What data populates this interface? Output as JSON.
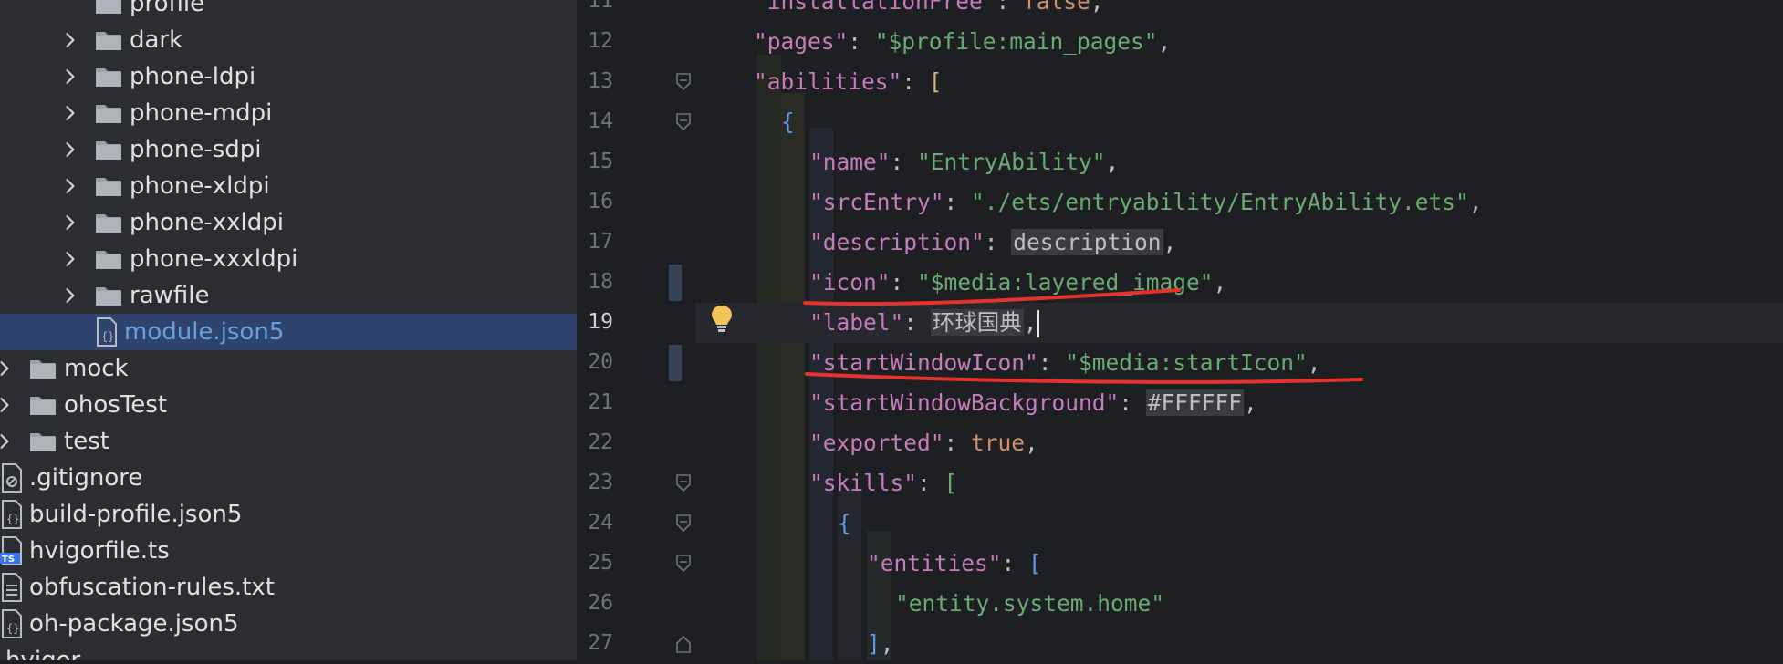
{
  "tree": {
    "items": [
      {
        "label": "profile",
        "kind": "folder",
        "expandable": false,
        "indent": 2
      },
      {
        "label": "dark",
        "kind": "folder",
        "expandable": true,
        "indent": 2
      },
      {
        "label": "phone-ldpi",
        "kind": "folder",
        "expandable": true,
        "indent": 2
      },
      {
        "label": "phone-mdpi",
        "kind": "folder",
        "expandable": true,
        "indent": 2
      },
      {
        "label": "phone-sdpi",
        "kind": "folder",
        "expandable": true,
        "indent": 2
      },
      {
        "label": "phone-xldpi",
        "kind": "folder",
        "expandable": true,
        "indent": 2
      },
      {
        "label": "phone-xxldpi",
        "kind": "folder",
        "expandable": true,
        "indent": 2
      },
      {
        "label": "phone-xxxldpi",
        "kind": "folder",
        "expandable": true,
        "indent": 2
      },
      {
        "label": "rawfile",
        "kind": "folder",
        "expandable": true,
        "indent": 2
      },
      {
        "label": "module.json5",
        "kind": "json5",
        "expandable": false,
        "indent": 2,
        "selected": true
      },
      {
        "label": "mock",
        "kind": "folder",
        "expandable": true,
        "indent": 1
      },
      {
        "label": "ohosTest",
        "kind": "folder",
        "expandable": true,
        "indent": 1
      },
      {
        "label": "test",
        "kind": "folder",
        "expandable": true,
        "indent": 1
      },
      {
        "label": ".gitignore",
        "kind": "ignore",
        "expandable": false,
        "indent": 0
      },
      {
        "label": "build-profile.json5",
        "kind": "json5",
        "expandable": false,
        "indent": 0
      },
      {
        "label": "hvigorfile.ts",
        "kind": "ts",
        "expandable": false,
        "indent": 0
      },
      {
        "label": "obfuscation-rules.txt",
        "kind": "txt",
        "expandable": false,
        "indent": 0
      },
      {
        "label": "oh-package.json5",
        "kind": "json5",
        "expandable": false,
        "indent": 0
      },
      {
        "label": "hvigor",
        "kind": "folder",
        "expandable": false,
        "indent": -1
      }
    ]
  },
  "editor": {
    "active_line": "19",
    "lines": [
      {
        "num": "11",
        "depth": 0,
        "html": "<span class=\"k\">\"installationFree\"</span><span class=\"p\">: </span><span class=\"o\">false</span><span class=\"p\">,</span>"
      },
      {
        "num": "12",
        "depth": 0,
        "html": "<span class=\"k\">\"pages\"</span><span class=\"p\">: </span><span class=\"s\">\"$profile:main_pages\"</span><span class=\"p\">,</span>"
      },
      {
        "num": "13",
        "depth": 0,
        "html": "<span class=\"k\">\"abilities\"</span><span class=\"p\">: </span><span class=\"y\">[</span>"
      },
      {
        "num": "14",
        "depth": 1,
        "html": "<span class=\"b\">{</span>"
      },
      {
        "num": "15",
        "depth": 2,
        "html": "<span class=\"k\">\"name\"</span><span class=\"p\">: </span><span class=\"s\">\"EntryAbility\"</span><span class=\"p\">,</span>"
      },
      {
        "num": "16",
        "depth": 2,
        "html": "<span class=\"k\">\"srcEntry\"</span><span class=\"p\">: </span><span class=\"s\">\"./ets/entryability/EntryAbility.ets\"</span><span class=\"p\">,</span>"
      },
      {
        "num": "17",
        "depth": 2,
        "html": "<span class=\"k\">\"description\"</span><span class=\"p\">: </span><span class=\"ph\">description</span><span class=\"p\">,</span>"
      },
      {
        "num": "18",
        "depth": 2,
        "html": "<span class=\"k\">\"icon\"</span><span class=\"p\">: </span><span class=\"s\">\"$media:layered_image\"</span><span class=\"p\">,</span>"
      },
      {
        "num": "19",
        "depth": 2,
        "html": "<span class=\"k\">\"label\"</span><span class=\"p\">: </span><span class=\"ph\">环球国典</span><span class=\"p\">,</span><span class=\"caret\"></span>"
      },
      {
        "num": "20",
        "depth": 2,
        "html": "<span class=\"k\">\"startWindowIcon\"</span><span class=\"p\">: </span><span class=\"s\">\"$media:startIcon\"</span><span class=\"p\">,</span>"
      },
      {
        "num": "21",
        "depth": 2,
        "html": "<span class=\"k\">\"startWindowBackground\"</span><span class=\"p\">: </span><span class=\"ph\">#FFFFFF</span><span class=\"p\">,</span>"
      },
      {
        "num": "22",
        "depth": 2,
        "html": "<span class=\"k\">\"exported\"</span><span class=\"p\">: </span><span class=\"o\">true</span><span class=\"p\">,</span>"
      },
      {
        "num": "23",
        "depth": 2,
        "html": "<span class=\"k\">\"skills\"</span><span class=\"p\">: </span><span class=\"s\">[</span>"
      },
      {
        "num": "24",
        "depth": 3,
        "html": "<span class=\"b\">{</span>"
      },
      {
        "num": "25",
        "depth": 4,
        "html": "<span class=\"k\">\"entities\"</span><span class=\"p\">: </span><span class=\"b\">[</span>"
      },
      {
        "num": "26",
        "depth": 5,
        "html": "<span class=\"s\">\"entity.system.home\"</span>"
      },
      {
        "num": "27",
        "depth": 4,
        "html": "<span class=\"b\">]</span><span class=\"p\">,</span>"
      }
    ]
  }
}
